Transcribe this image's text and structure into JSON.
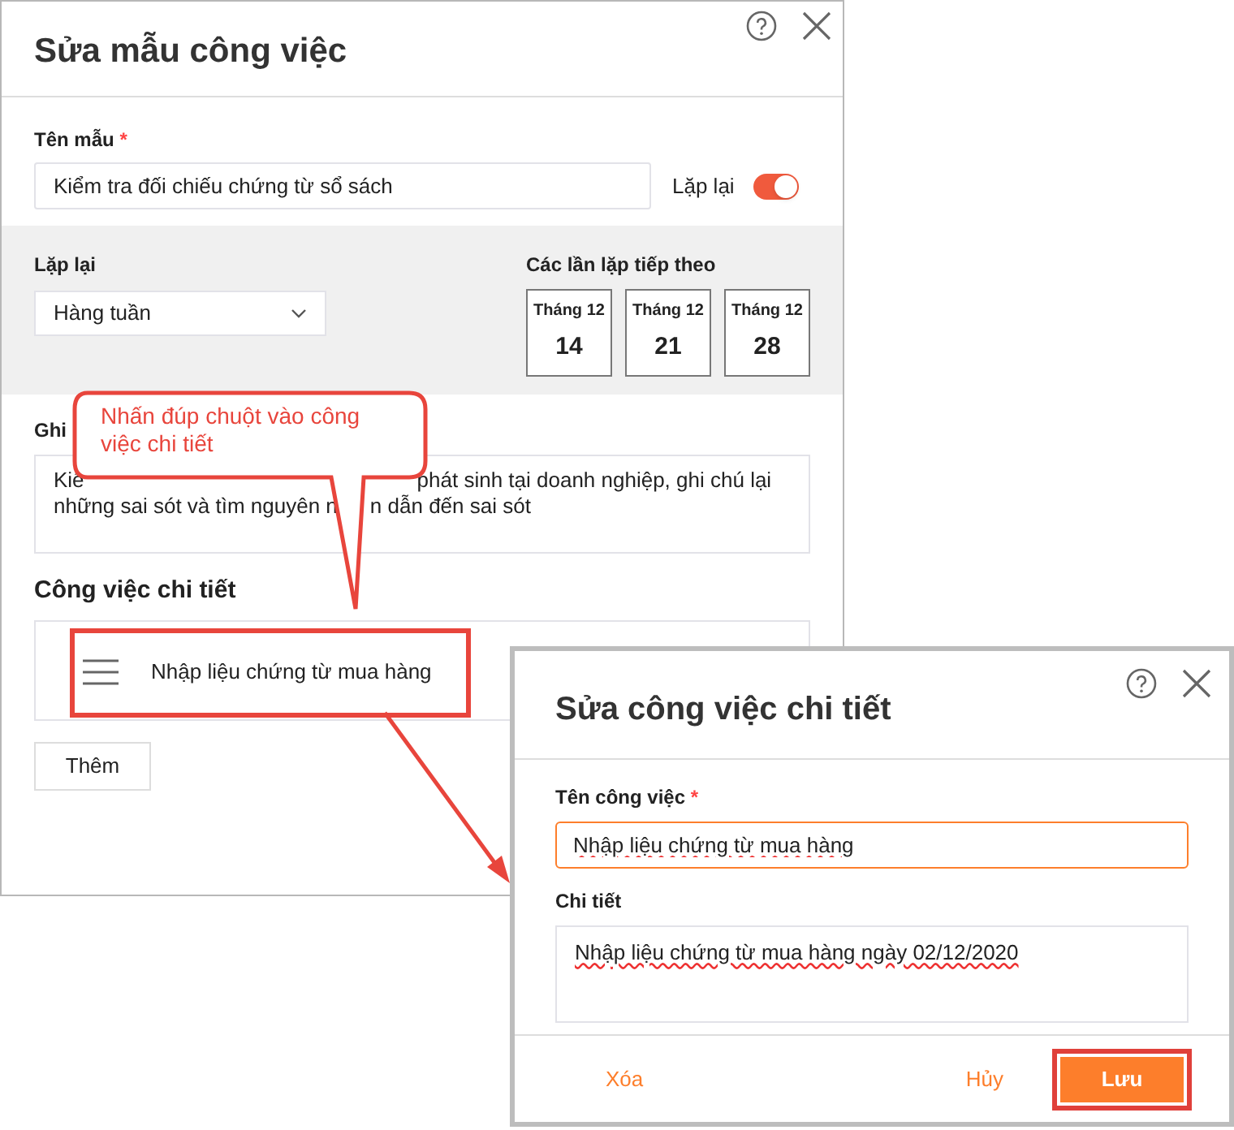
{
  "main_dialog": {
    "title": "Sửa mẫu công việc",
    "name_label": "Tên mẫu",
    "required_mark": "*",
    "name_value": "Kiểm tra đối chiếu chứng từ sổ sách",
    "repeat_toggle": {
      "label": "Lặp lại",
      "on": true
    },
    "repeat_label": "Lặp lại",
    "repeat_value": "Hàng tuần",
    "next_label": "Các lần lặp tiếp theo",
    "next_dates": [
      {
        "month": "Tháng 12",
        "day": "14"
      },
      {
        "month": "Tháng 12",
        "day": "21"
      },
      {
        "month": "Tháng 12",
        "day": "28"
      }
    ],
    "notes_label": "Ghi",
    "notes_lines": [
      [
        "Kiể",
        "phát sinh tại doanh nghiệp, ghi chú lại"
      ],
      [
        "những sai sót và tìm nguyên n",
        "n dẫn đến sai sót"
      ]
    ],
    "tasks_title": "Công việc chi tiết",
    "tasks": [
      "Nhập liệu chứng từ mua hàng"
    ],
    "add_button": "Thêm"
  },
  "callout": {
    "text": "Nhấn đúp chuột vào công việc chi tiết"
  },
  "detail_dialog": {
    "title": "Sửa công việc chi tiết",
    "name_label": "Tên công việc",
    "required_mark": "*",
    "name_value": "Nhập liệu chứng từ mua hàng",
    "detail_label": "Chi tiết",
    "detail_value": "Nhập liệu chứng từ mua hàng ngày 02/12/2020",
    "buttons": [
      {
        "kind": "link",
        "label": "Xóa"
      },
      {
        "kind": "link",
        "label": "Hủy"
      },
      {
        "kind": "primary",
        "label": "Lưu"
      }
    ]
  }
}
